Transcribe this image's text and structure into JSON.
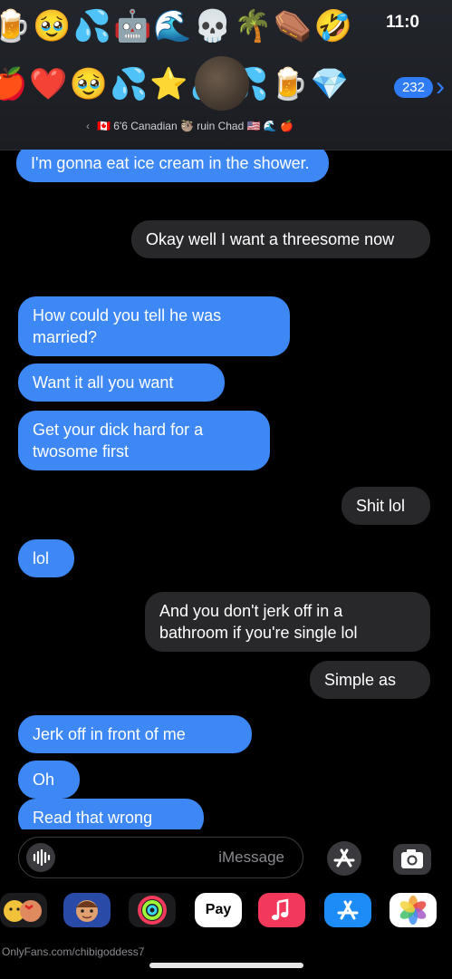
{
  "status_bar": {
    "time": "11:0"
  },
  "header": {
    "emoji_row_1": [
      "🍺",
      "🥹",
      "💦",
      "🤖",
      "🌊",
      "💀",
      "🌴",
      "⚰️",
      "🤣"
    ],
    "emoji_row_2": [
      "🍎",
      "❤️",
      "🥹",
      "💦",
      "⭐",
      "💦",
      "💦",
      "🍺",
      "💎"
    ],
    "back_badge": "232",
    "contact_name": "🇨🇦 6'6 Canadian 🦥 ruin Chad 🇺🇸 🌊 🍎",
    "contact_chevron": "‹"
  },
  "messages": [
    {
      "from": "contact",
      "text": "I'm gonna eat ice cream in the shower."
    },
    {
      "from": "me",
      "text": "Okay well I want a threesome now"
    },
    {
      "from": "contact",
      "text": "How could you tell he was married?"
    },
    {
      "from": "contact",
      "text": "Want it all you want"
    },
    {
      "from": "contact",
      "text": "Get your dick hard for a twosome first"
    },
    {
      "from": "me",
      "text": "Shit lol"
    },
    {
      "from": "contact",
      "text": "lol"
    },
    {
      "from": "me",
      "text": "And you don't jerk off in a bathroom if you're single lol"
    },
    {
      "from": "me",
      "text": "Simple as"
    },
    {
      "from": "contact",
      "text": "Jerk off in front of me"
    },
    {
      "from": "contact",
      "text": "Oh"
    },
    {
      "from": "contact",
      "text": "Read that wrong"
    }
  ],
  "composer": {
    "placeholder": "iMessage",
    "audio_icon": "waveform-icon",
    "appstore_icon": "app-store-icon",
    "camera_icon": "camera-icon"
  },
  "app_drawer": [
    {
      "name": "photos",
      "icon": "photos-icon"
    },
    {
      "name": "app-store",
      "icon": "app-store-icon"
    },
    {
      "name": "music",
      "icon": "music-icon"
    },
    {
      "name": "apple-pay",
      "label": "Pay",
      "icon": "apple-pay-icon"
    },
    {
      "name": "fitness",
      "icon": "activity-rings-icon"
    },
    {
      "name": "memoji",
      "icon": "memoji-icon"
    },
    {
      "name": "memoji-stickers",
      "icon": "memoji-stickers-icon"
    }
  ],
  "watermark": "OnlyFans.com/chibigoddess7",
  "colors": {
    "sent_blue": "#3d88f5",
    "received_gray": "#28282b",
    "accent": "#2f7cf6",
    "background": "#000000"
  }
}
